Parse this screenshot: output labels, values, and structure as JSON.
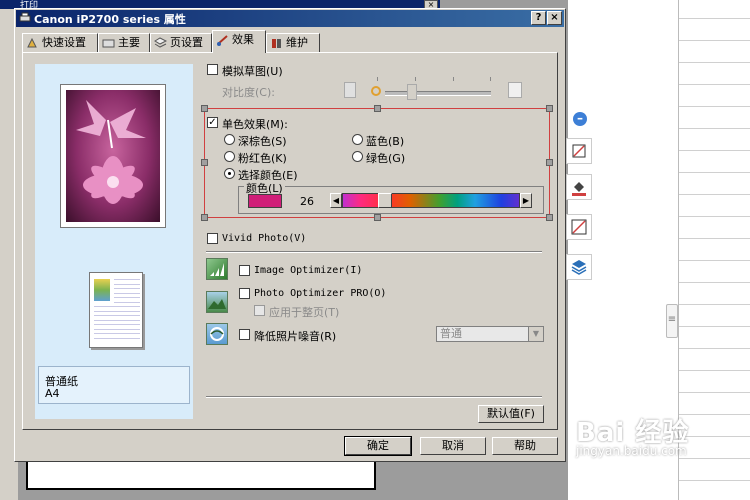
{
  "background": {
    "window_title": "打印"
  },
  "dialog": {
    "title": "Canon iP2700 series 属性",
    "help_button": "?",
    "close_button": "×",
    "tabs": [
      {
        "label": "快速设置",
        "icon": "quick-setup-icon"
      },
      {
        "label": "主要",
        "icon": "main-icon"
      },
      {
        "label": "页设置",
        "icon": "page-setup-icon"
      },
      {
        "label": "效果",
        "icon": "effects-icon",
        "active": true
      },
      {
        "label": "维护",
        "icon": "maintenance-icon"
      }
    ]
  },
  "preview": {
    "media_type": "普通纸",
    "paper_size": "A4"
  },
  "effects": {
    "simulate_sketch": {
      "label": "模拟草图(U)",
      "checked": false
    },
    "contrast": {
      "label": "对比度(C):",
      "level_fraction": 0.3
    },
    "monochrome": {
      "label": "单色效果(M):",
      "checked": true,
      "options": [
        {
          "label": "深棕色(S)",
          "selected": false
        },
        {
          "label": "蓝色(B)",
          "selected": false
        },
        {
          "label": "粉红色(K)",
          "selected": false
        },
        {
          "label": "绿色(G)",
          "selected": false
        },
        {
          "label": "选择颜色(E)",
          "selected": true
        }
      ],
      "color_group_label": "颜色(L)",
      "color_value": "26",
      "swatch_color": "#d01e78"
    },
    "vivid_photo": {
      "label": "Vivid Photo(V)",
      "checked": false
    },
    "image_optimizer": {
      "label": "Image Optimizer(I)",
      "checked": false
    },
    "photo_optimizer_pro": {
      "label": "Photo Optimizer PRO(O)",
      "checked": false
    },
    "apply_all_pages": {
      "label": "应用于整页(T)",
      "checked": false,
      "enabled": false
    },
    "noise_reduction": {
      "label": "降低照片噪音(R)",
      "checked": false
    },
    "noise_level": {
      "value": "普通",
      "enabled": false
    },
    "defaults_button": "默认值(F)"
  },
  "footer": {
    "ok": "确定",
    "cancel": "取消",
    "help": "帮助"
  },
  "watermark": {
    "text": "Bai 经验",
    "url": "jingyan.baidu.com"
  },
  "colors": {
    "titlebar": "#0a246a",
    "face": "#d4d0c8",
    "selection_frame": "#d04040",
    "preview_bg": "#d8ecfa"
  }
}
